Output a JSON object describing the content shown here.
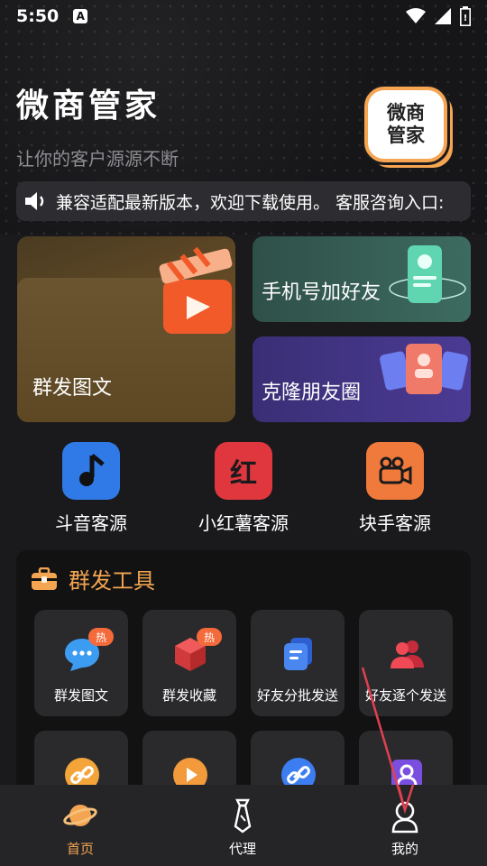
{
  "status_bar": {
    "time": "5:50",
    "notice_icon": "A"
  },
  "app": {
    "title": "微商管家",
    "subtitle": "让你的客户源源不断",
    "logo_text_line1": "微商",
    "logo_text_line2": "管家"
  },
  "announcement": {
    "text": "兼容适配最新版本，欢迎下载使用。  客服咨询入口:"
  },
  "feature_cards": {
    "mass_image_text": "群发图文",
    "phone_add_friend": "手机号加好友",
    "clone_moments": "克隆朋友圈"
  },
  "source_apps": [
    {
      "label": "斗音客源",
      "color": "#2f7ae6",
      "icon": "music-note-icon"
    },
    {
      "label": "小红薯客源",
      "color": "#e0373f",
      "icon": "red-book-icon",
      "glyph": "红"
    },
    {
      "label": "块手客源",
      "color": "#f07a3b",
      "icon": "video-camera-icon"
    }
  ],
  "tools_section": {
    "title": "群发工具",
    "items": [
      {
        "label": "群发图文",
        "badge": "热"
      },
      {
        "label": "群发收藏",
        "badge": "热"
      },
      {
        "label": "好友分批发送"
      },
      {
        "label": "好友逐个发送"
      }
    ]
  },
  "tabbar": {
    "items": [
      {
        "label": "首页",
        "active": true
      },
      {
        "label": "代理",
        "active": false
      },
      {
        "label": "我的",
        "active": false
      }
    ]
  },
  "colors": {
    "accent": "#f3a551",
    "background": "#1a1a1c",
    "annotation_arrow": "#e04050"
  }
}
